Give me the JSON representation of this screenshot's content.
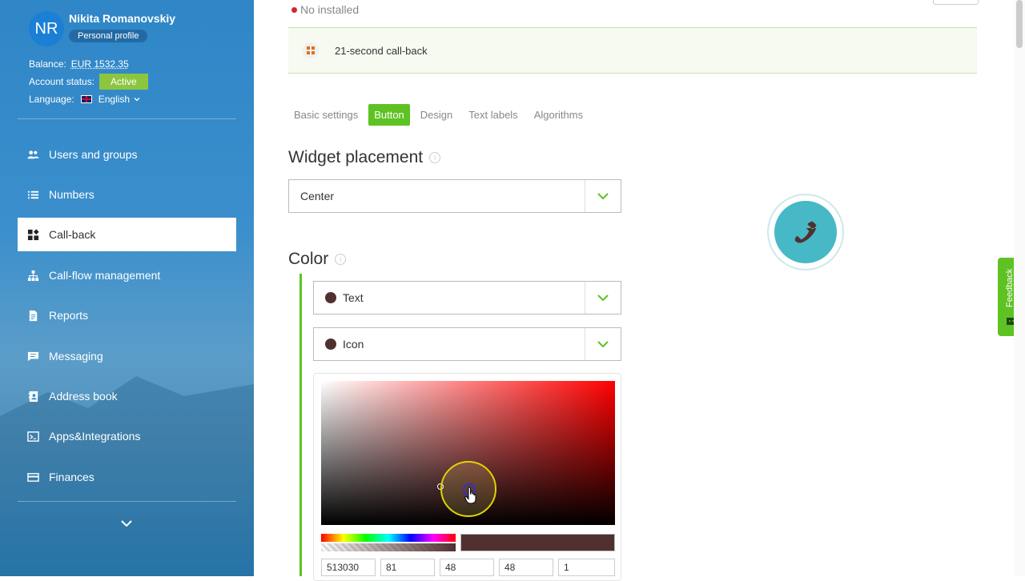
{
  "user": {
    "initials": "NR",
    "name": "Nikita Romanovskiy",
    "profile_label": "Personal profile",
    "balance_label": "Balance:",
    "balance_value": "EUR 1532.35",
    "status_label": "Account status:",
    "status_value": "Active",
    "language_label": "Language:",
    "language_value": "English"
  },
  "nav": {
    "items": [
      {
        "label": "Users and groups",
        "icon": "users-icon"
      },
      {
        "label": "Numbers",
        "icon": "list-icon"
      },
      {
        "label": "Call-back",
        "icon": "widgets-icon"
      },
      {
        "label": "Call-flow management",
        "icon": "sitemap-icon"
      },
      {
        "label": "Reports",
        "icon": "document-icon"
      },
      {
        "label": "Messaging",
        "icon": "message-icon"
      },
      {
        "label": "Address book",
        "icon": "address-book-icon"
      },
      {
        "label": "Apps&Integrations",
        "icon": "terminal-icon"
      },
      {
        "label": "Finances",
        "icon": "card-icon"
      }
    ],
    "active_index": 2
  },
  "widget": {
    "status": "No installed",
    "name": "21-second call-back"
  },
  "tabs": [
    "Basic settings",
    "Button",
    "Design",
    "Text labels",
    "Algorithms"
  ],
  "active_tab": "Button",
  "placement": {
    "title": "Widget placement",
    "value": "Center"
  },
  "color": {
    "title": "Color",
    "text_option": "Text",
    "icon_option": "Icon",
    "swatch_color": "#513030",
    "picker": {
      "hex": "513030",
      "r": "81",
      "g": "48",
      "b": "48",
      "a": "1"
    }
  },
  "feedback": {
    "label": "Feedback"
  },
  "colors": {
    "accent": "#5ec223",
    "sidebar": "#2f86c7",
    "widget_button": "#46b8c6",
    "status_dot": "#d0272d"
  }
}
